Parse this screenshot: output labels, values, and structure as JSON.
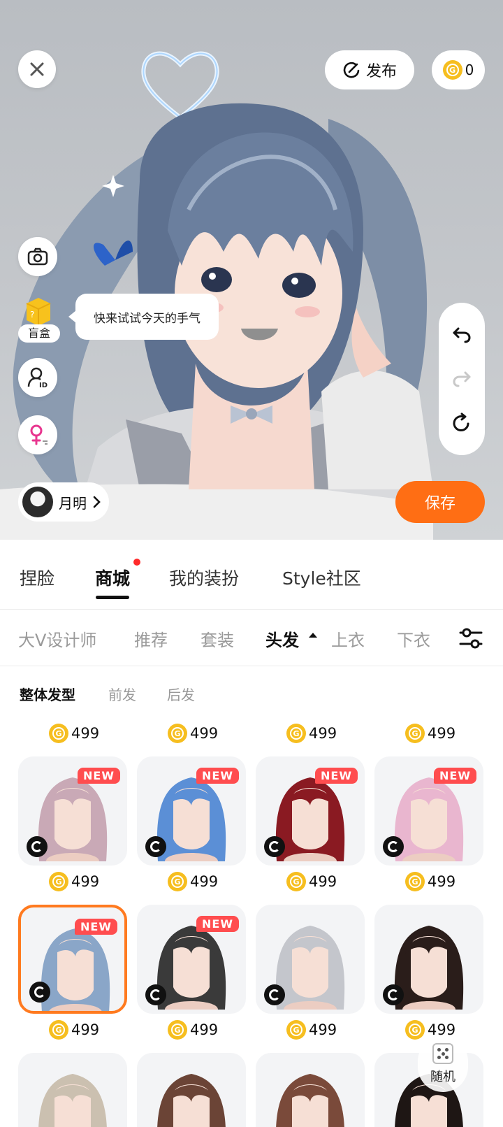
{
  "header": {
    "publish_label": "发布",
    "coin_balance": "0"
  },
  "left_tools": {
    "blindbox_label": "盲盒",
    "bubble_text": "快来试试今天的手气"
  },
  "profile": {
    "name": "月明"
  },
  "save_label": "保存",
  "main_tabs": [
    {
      "label": "捏脸"
    },
    {
      "label": "商城"
    },
    {
      "label": "我的装扮"
    },
    {
      "label": "Style社区"
    }
  ],
  "category_tabs": [
    {
      "label": "大V设计师"
    },
    {
      "label": "推荐"
    },
    {
      "label": "套装"
    },
    {
      "label": "头发"
    },
    {
      "label": "上衣"
    },
    {
      "label": "下衣"
    }
  ],
  "sub_tabs": [
    {
      "label": "整体发型"
    },
    {
      "label": "前发"
    },
    {
      "label": "后发"
    }
  ],
  "new_badge": "NEW",
  "top_row_prices": [
    "499",
    "499",
    "499",
    "499"
  ],
  "items": [
    {
      "price": "499",
      "new": true,
      "color": "#c9a9b6"
    },
    {
      "price": "499",
      "new": true,
      "color": "#5b8fd6"
    },
    {
      "price": "499",
      "new": true,
      "color": "#8a1a22"
    },
    {
      "price": "499",
      "new": true,
      "color": "#e9b6cf"
    },
    {
      "price": "499",
      "new": true,
      "color": "#8aa6c8",
      "selected": true
    },
    {
      "price": "499",
      "new": true,
      "color": "#3a3a3a"
    },
    {
      "price": "499",
      "new": false,
      "color": "#c4c6cc"
    },
    {
      "price": "499",
      "new": false,
      "color": "#2a1d1a"
    },
    {
      "color": "#cbc0b0"
    },
    {
      "color": "#6b4436"
    },
    {
      "color": "#7a4a3a"
    },
    {
      "color": "#1e1614"
    }
  ],
  "random_label": "随机"
}
